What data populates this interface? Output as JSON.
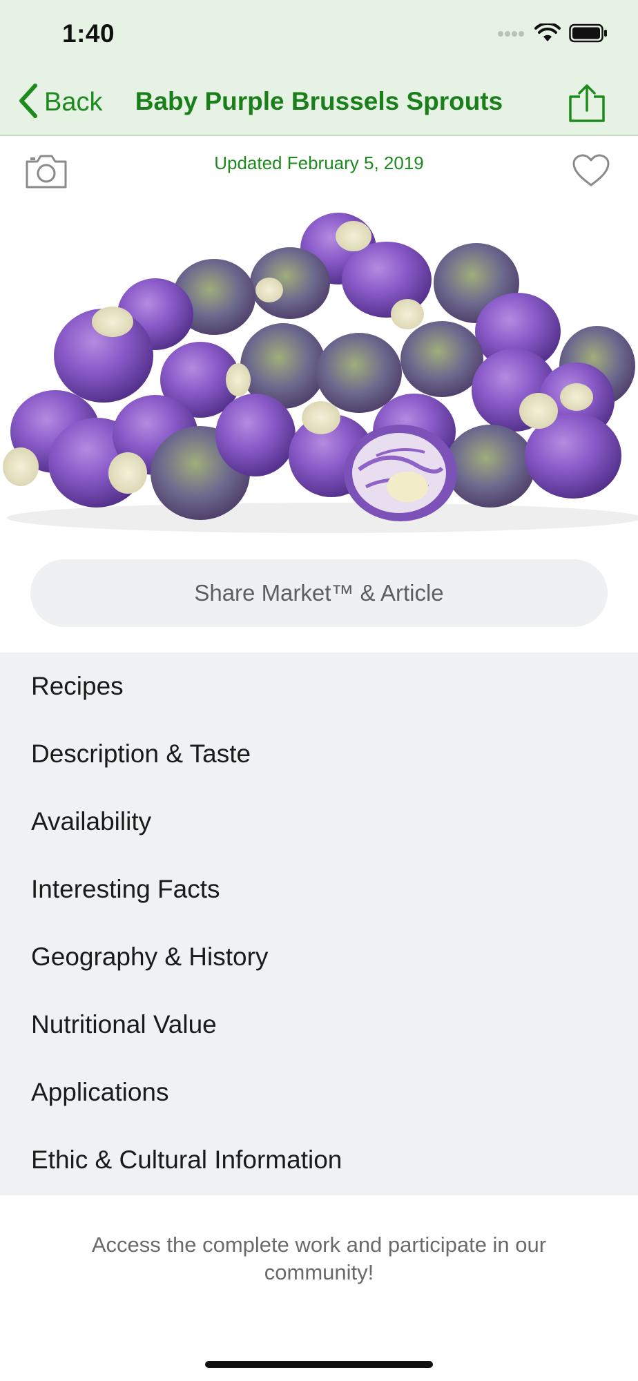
{
  "status_bar": {
    "time": "1:40"
  },
  "nav": {
    "back_label": "Back",
    "title": "Baby Purple Brussels Sprouts"
  },
  "article": {
    "updated": "Updated February 5, 2019",
    "share_button": "Share Market™ & Article"
  },
  "menu": {
    "items": [
      {
        "label": "Recipes"
      },
      {
        "label": "Description & Taste"
      },
      {
        "label": "Availability"
      },
      {
        "label": "Interesting Facts"
      },
      {
        "label": "Geography & History"
      },
      {
        "label": "Nutritional Value"
      },
      {
        "label": "Applications"
      },
      {
        "label": "Ethic & Cultural Information"
      }
    ]
  },
  "footer": {
    "text": "Access the complete work and participate in our community!"
  },
  "icons": {
    "back": "chevron-left-icon",
    "share": "share-icon",
    "camera": "camera-icon",
    "favorite": "heart-icon",
    "signal": "cellular-signal-icon",
    "wifi": "wifi-icon",
    "battery": "battery-icon"
  },
  "colors": {
    "brand_green": "#1d8a1d",
    "header_bg": "#e6f2e3",
    "list_bg": "#eff1f3"
  }
}
